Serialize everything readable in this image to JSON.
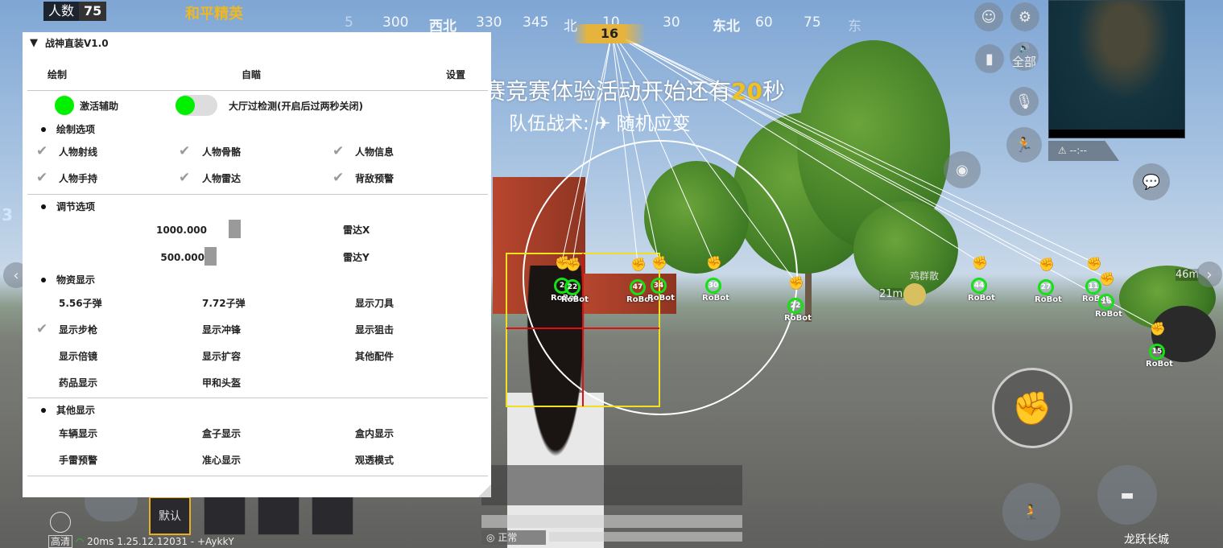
{
  "hud": {
    "player_count_label": "人数",
    "player_count": "75",
    "game_logo": "和平精英",
    "compass": [
      "5",
      "300",
      "西北",
      "330",
      "345",
      "北",
      "10",
      "30",
      "东北",
      "60",
      "75",
      "东"
    ],
    "heading": "16",
    "announcement": "赛竞赛体验活动开始还有",
    "countdown": "20",
    "announcement_suffix": "秒",
    "tactic_label": "队伍战术:",
    "tactic_value": "随机应变",
    "voice_label": "全部",
    "minimap_warning": "--:--",
    "scene_sign": "鸡群散",
    "distance_near": "21m",
    "distance_right": "46m",
    "left_edge_number": "3",
    "slots": [
      "默认",
      "",
      "",
      ""
    ],
    "quality": "高清",
    "ping": "20ms",
    "version": "1.25.12.12031 - +AykkY",
    "status": "正常",
    "bottom_right": "龙跃长城",
    "colors": {
      "esp_ring": "#16e016",
      "box": "#f0e020",
      "crosshair": "#e01010",
      "countdown": "#f2c21a"
    }
  },
  "esp": {
    "label": "RoBot",
    "targets": [
      "2",
      "22",
      "47",
      "34",
      "30",
      "22",
      "44",
      "27",
      "11",
      "16",
      "15"
    ]
  },
  "menu": {
    "title": "战神直装V1.0",
    "tabs": [
      "绘制",
      "自瞄",
      "设置"
    ],
    "activate": {
      "label": "激活辅助",
      "on": true
    },
    "lobby": {
      "label": "大厅过检测(开启后过两秒关闭)",
      "on": true
    },
    "draw_section": "绘制选项",
    "draw_options": [
      {
        "label": "人物射线",
        "checked": true
      },
      {
        "label": "人物骨骼",
        "checked": true
      },
      {
        "label": "人物信息",
        "checked": true
      },
      {
        "label": "人物手持",
        "checked": true
      },
      {
        "label": "人物雷达",
        "checked": true
      },
      {
        "label": "背敌预警",
        "checked": true
      }
    ],
    "adjust_section": "调节选项",
    "sliders": [
      {
        "value": "1000.000",
        "label": "雷达X"
      },
      {
        "value": "500.000",
        "label": "雷达Y"
      }
    ],
    "items_section": "物资显示",
    "items": [
      {
        "label": "5.56子弹",
        "checked": false
      },
      {
        "label": "7.72子弹",
        "checked": false
      },
      {
        "label": "显示刀具",
        "checked": false
      },
      {
        "label": "显示步枪",
        "checked": true
      },
      {
        "label": "显示冲锋",
        "checked": false
      },
      {
        "label": "显示狙击",
        "checked": false
      },
      {
        "label": "显示倍镜",
        "checked": false
      },
      {
        "label": "显示扩容",
        "checked": false
      },
      {
        "label": "其他配件",
        "checked": false
      },
      {
        "label": "药品显示",
        "checked": false
      },
      {
        "label": "甲和头盔",
        "checked": false
      }
    ],
    "other_section": "其他显示",
    "others": [
      {
        "label": "车辆显示",
        "checked": false
      },
      {
        "label": "盒子显示",
        "checked": false
      },
      {
        "label": "盒内显示",
        "checked": false
      },
      {
        "label": "手雷预警",
        "checked": false
      },
      {
        "label": "准心显示",
        "checked": false
      },
      {
        "label": "观透模式",
        "checked": false
      }
    ]
  }
}
